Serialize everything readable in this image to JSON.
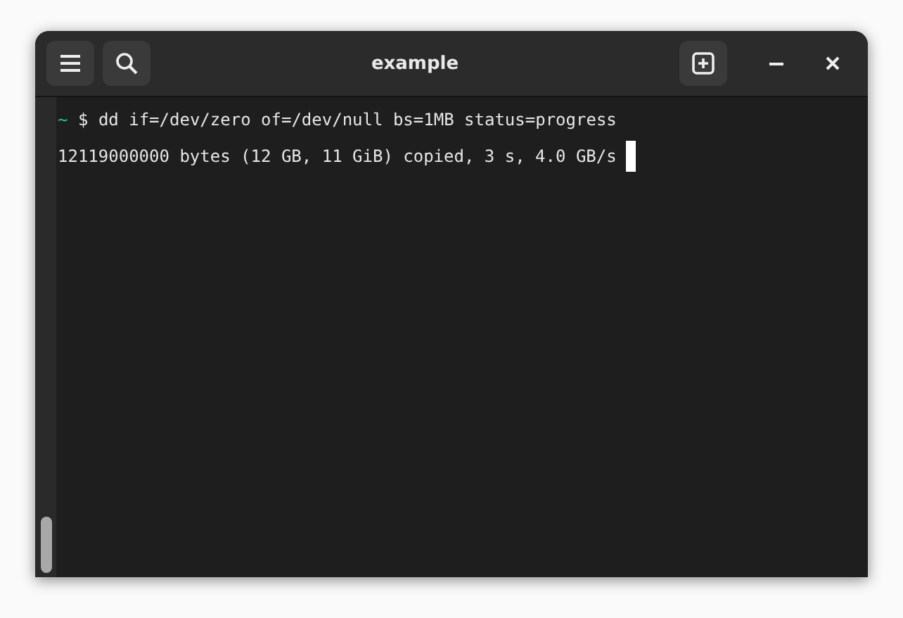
{
  "window": {
    "title": "example"
  },
  "terminal": {
    "lines": [
      {
        "kind": "command",
        "dir": "~",
        "sign": "$",
        "text": "dd if=/dev/zero of=/dev/null bs=1MB status=progress"
      },
      {
        "kind": "output",
        "text": "12119000000 bytes (12 GB, 11 GiB) copied, 3 s, 4.0 GB/s",
        "cursor": true
      }
    ]
  }
}
